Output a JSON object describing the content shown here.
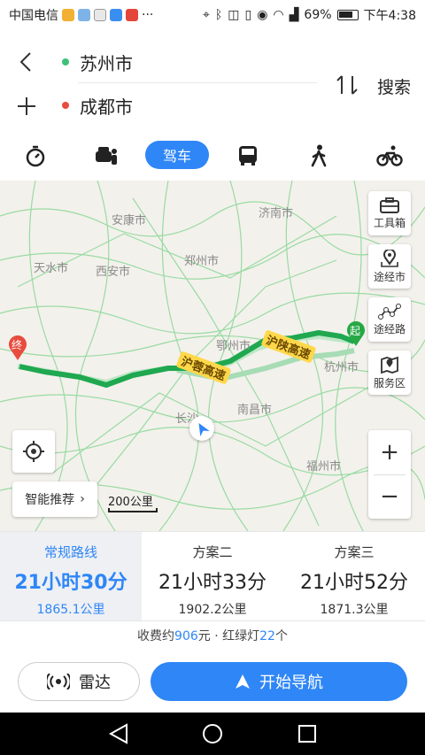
{
  "statusbar": {
    "carrier": "中国电信",
    "battery": "69%",
    "time": "下午4:38"
  },
  "search": {
    "origin": "苏州市",
    "destination": "成都市",
    "search_label": "搜索"
  },
  "modes": {
    "drive_label": "驾车"
  },
  "map": {
    "labels": [
      "郑州市",
      "济南市",
      "西安市",
      "南昌市",
      "杭州市",
      "福州市",
      "长沙",
      "天水市",
      "安康市",
      "鄂州市"
    ],
    "road_1": "沪蓉高速",
    "road_2": "沪陕高速",
    "start_marker": "起",
    "end_marker": "终",
    "scale": "200公里",
    "smart_recommend": "智能推荐",
    "tools": {
      "toolbox": "工具箱",
      "via_city": "途经市",
      "via_road": "途经路",
      "service": "服务区"
    },
    "zoom_in": "+",
    "zoom_out": "−"
  },
  "routes": [
    {
      "name": "常规路线",
      "time": "21小时30分",
      "distance": "1865.1公里"
    },
    {
      "name": "方案二",
      "time": "21小时33分",
      "distance": "1902.2公里"
    },
    {
      "name": "方案三",
      "time": "21小时52分",
      "distance": "1871.3公里"
    }
  ],
  "fee": {
    "prefix": "收费约",
    "amount": "906",
    "middle": "元 · 红绿灯",
    "lights": "22",
    "suffix": "个"
  },
  "actions": {
    "radar": "雷达",
    "navigate": "开始导航"
  },
  "colors": {
    "accent": "#2f86f6",
    "route_main": "#1fa84f",
    "route_alt": "#9fd9b0",
    "end_marker": "#e84c3d",
    "start_marker": "#27a845"
  }
}
